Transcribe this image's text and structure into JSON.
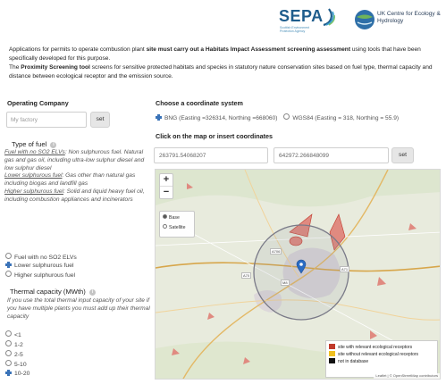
{
  "header": {
    "sepa_name": "SEPA",
    "sepa_subtitle": "Scottish Environment Protection Agency",
    "ukceh_name": "UK Centre for Ecology & Hydrology"
  },
  "intro": {
    "line1_pre": "Applications for permits to operate combustion plant ",
    "line1_bold": "site must carry out a Habitats Impact Assessment screening assessment",
    "line1_post": " using tools that have been specifically developed for this purpose.",
    "line2_pre": "The ",
    "line2_bold": "Proximity Screening tool",
    "line2_post": " screens for sensitive protected habitats and species in statutory nature conservation sites based on fuel type, thermal capacity and distance between ecological receptor and the emission source."
  },
  "operating_company": {
    "heading": "Operating Company",
    "placeholder": "My factory",
    "set_label": "set"
  },
  "fuel": {
    "heading": "Type of fuel",
    "info": "i",
    "desc1_u": "Fuel with no SO2 ELVs",
    "desc1_rest": ": Non sulphurous fuel. Natural gas and gas oil, including ultra-low sulphur diesel and low sulphur diesel",
    "desc2_u": "Lower sulphurous fuel",
    "desc2_rest": ": Gas other than natural gas including biogas and landfill gas",
    "desc3_u": "Higher sulphurous fuel",
    "desc3_rest": ": Solid and liquid heavy fuel oil, including combustion appliances and incinerators",
    "options": [
      "Fuel with no SO2 ELVs",
      "Lower sulphurous fuel",
      "Higher sulphurous fuel"
    ],
    "selected_index": 1
  },
  "thermal": {
    "heading": "Thermal capacity (MWth)",
    "info": "i",
    "desc": "If you use the total thermal input capacity of your site if you have multiple plants you must add up their thermal capacity",
    "options": [
      "<1",
      "1-2",
      "2-5",
      "5-10",
      "10-20"
    ],
    "selected_index": 4
  },
  "coordinate_system": {
    "heading": "Choose a coordinate system",
    "option1": "BNG (Easting =326314, Northing =668060)",
    "option2": "WGS84 (Easting = 318, Northing = 55.9)",
    "selected_index": 0
  },
  "click_map": {
    "heading": "Click on the map or insert coordinates",
    "coord1_value": "263791.54068207",
    "coord2_value": "642972.266848099",
    "set_label": "set"
  },
  "map": {
    "zoom_in": "+",
    "zoom_out": "−",
    "layers": [
      "Base",
      "Satellite"
    ],
    "selected_layer_index": 0,
    "legend": [
      {
        "label": "site with relevant ecological receptors",
        "color": "#c0392b"
      },
      {
        "label": "site without relevant ecological receptors",
        "color": "#f0c020"
      },
      {
        "label": "not in database",
        "color": "#111111"
      }
    ],
    "attribution": "Leaflet | © OpenStreetMap contributors",
    "road_labels": [
      "A706",
      "A71",
      "M8",
      "A70"
    ],
    "marker_color": "#2b6cc4"
  }
}
